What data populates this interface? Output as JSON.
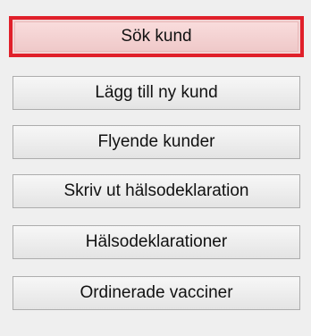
{
  "menu": {
    "items": [
      {
        "label": "Sök kund",
        "selected": true
      },
      {
        "label": "Lägg till ny kund",
        "selected": false
      },
      {
        "label": "Flyende kunder",
        "selected": false
      },
      {
        "label": "Skriv ut hälsodeklaration",
        "selected": false
      },
      {
        "label": "Hälsodeklarationer",
        "selected": false
      },
      {
        "label": "Ordinerade vacciner",
        "selected": false
      }
    ]
  },
  "colors": {
    "background": "#efefef",
    "selected_border": "#e0202a",
    "selected_fill": "#f3d3d3",
    "button_border": "#adadad"
  }
}
